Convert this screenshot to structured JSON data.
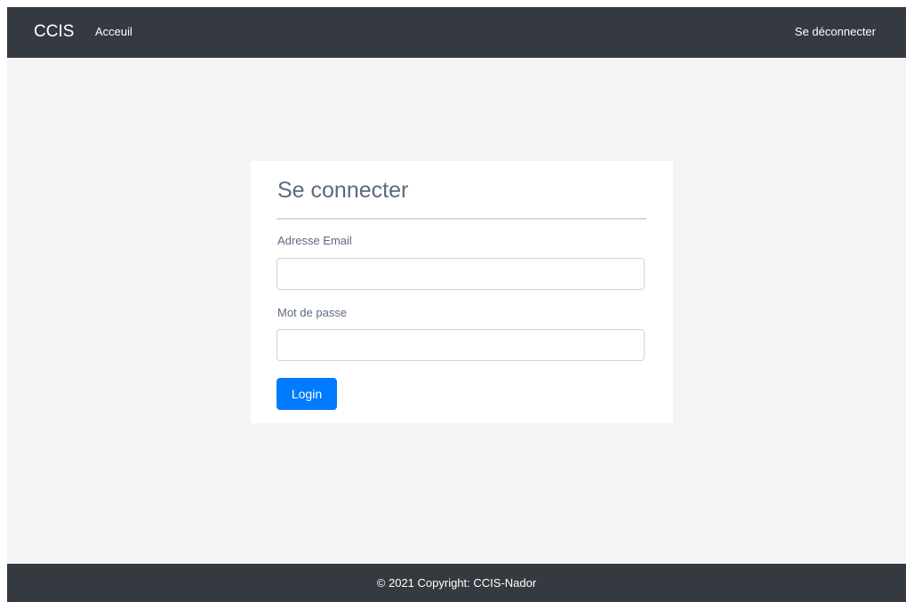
{
  "navbar": {
    "brand": "CCIS",
    "home_link": "Acceuil",
    "logout_link": "Se déconnecter"
  },
  "login_form": {
    "title": "Se connecter",
    "email_label": "Adresse Email",
    "email_value": "",
    "email_placeholder": "",
    "password_label": "Mot de passe",
    "password_value": "",
    "password_placeholder": "",
    "submit_label": "Login"
  },
  "footer": {
    "text": "© 2021 Copyright: CCIS-Nador"
  },
  "colors": {
    "navbar_bg": "#343a40",
    "page_bg": "#f4f4f4",
    "primary_button": "#007bff",
    "title_text": "#5b6a82"
  }
}
